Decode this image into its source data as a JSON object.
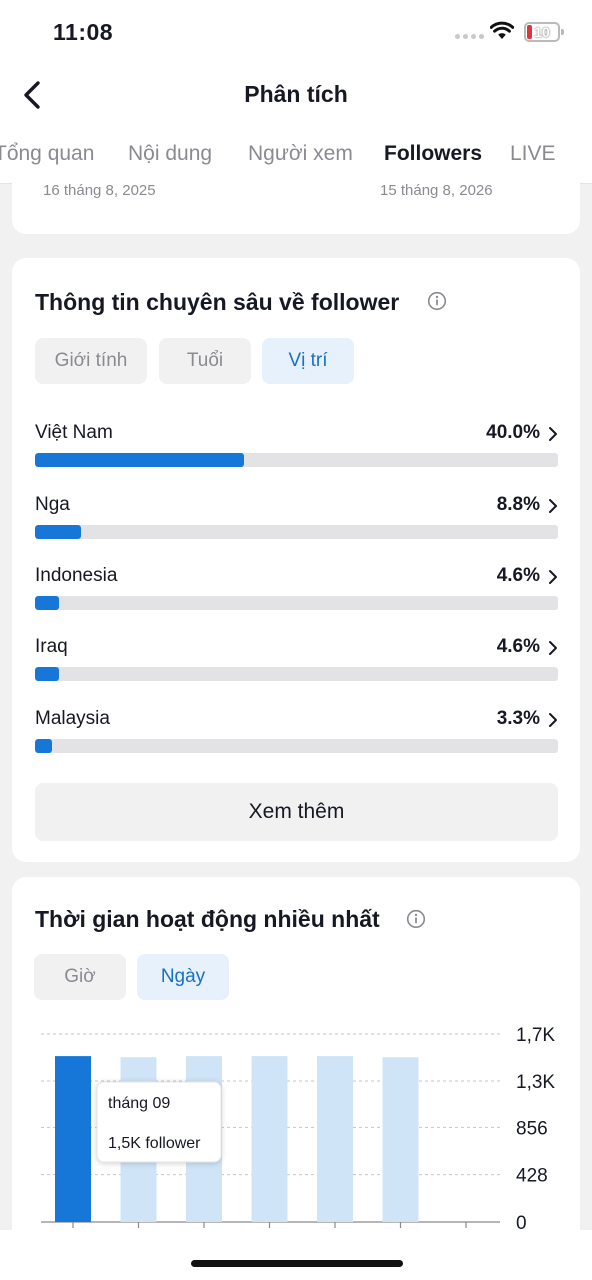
{
  "status": {
    "time": "11:08",
    "battery": "10"
  },
  "nav": {
    "title": "Phân tích"
  },
  "tabs": [
    "Tổng quan",
    "Nội dung",
    "Người xem",
    "Followers",
    "LIVE"
  ],
  "date_range": {
    "start": "16 tháng 8, 2025",
    "end": "15 tháng 8, 2026"
  },
  "insight": {
    "title": "Thông tin chuyên sâu về follower",
    "filters": [
      "Giới tính",
      "Tuổi",
      "Vị trí"
    ],
    "active_filter": "Vị trí",
    "locations": [
      {
        "name": "Việt Nam",
        "pct_label": "40.0%",
        "pct": 40.0
      },
      {
        "name": "Nga",
        "pct_label": "8.8%",
        "pct": 8.8
      },
      {
        "name": "Indonesia",
        "pct_label": "4.6%",
        "pct": 4.6
      },
      {
        "name": "Iraq",
        "pct_label": "4.6%",
        "pct": 4.6
      },
      {
        "name": "Malaysia",
        "pct_label": "3.3%",
        "pct": 3.3
      }
    ],
    "more_label": "Xem thêm"
  },
  "active_time": {
    "title": "Thời gian hoạt động nhiều nhất",
    "filters": [
      "Giờ",
      "Ngày"
    ],
    "active_filter": "Ngày",
    "tooltip": {
      "label": "tháng 09",
      "value": "1,5K follower"
    }
  },
  "colors": {
    "accent": "#1677d9",
    "bar_light": "#cfe4f7",
    "text": "#161823",
    "muted": "#8a8b91"
  },
  "chart_data": {
    "type": "bar",
    "categories": [
      "",
      "",
      "",
      "",
      "",
      ""
    ],
    "values": [
      1500,
      1490,
      1500,
      1500,
      1500,
      1490
    ],
    "highlight_index": 0,
    "ylim": [
      0,
      1700
    ],
    "y_ticks": [
      "0",
      "428",
      "856",
      "1,3K",
      "1,7K"
    ],
    "grid": true
  }
}
